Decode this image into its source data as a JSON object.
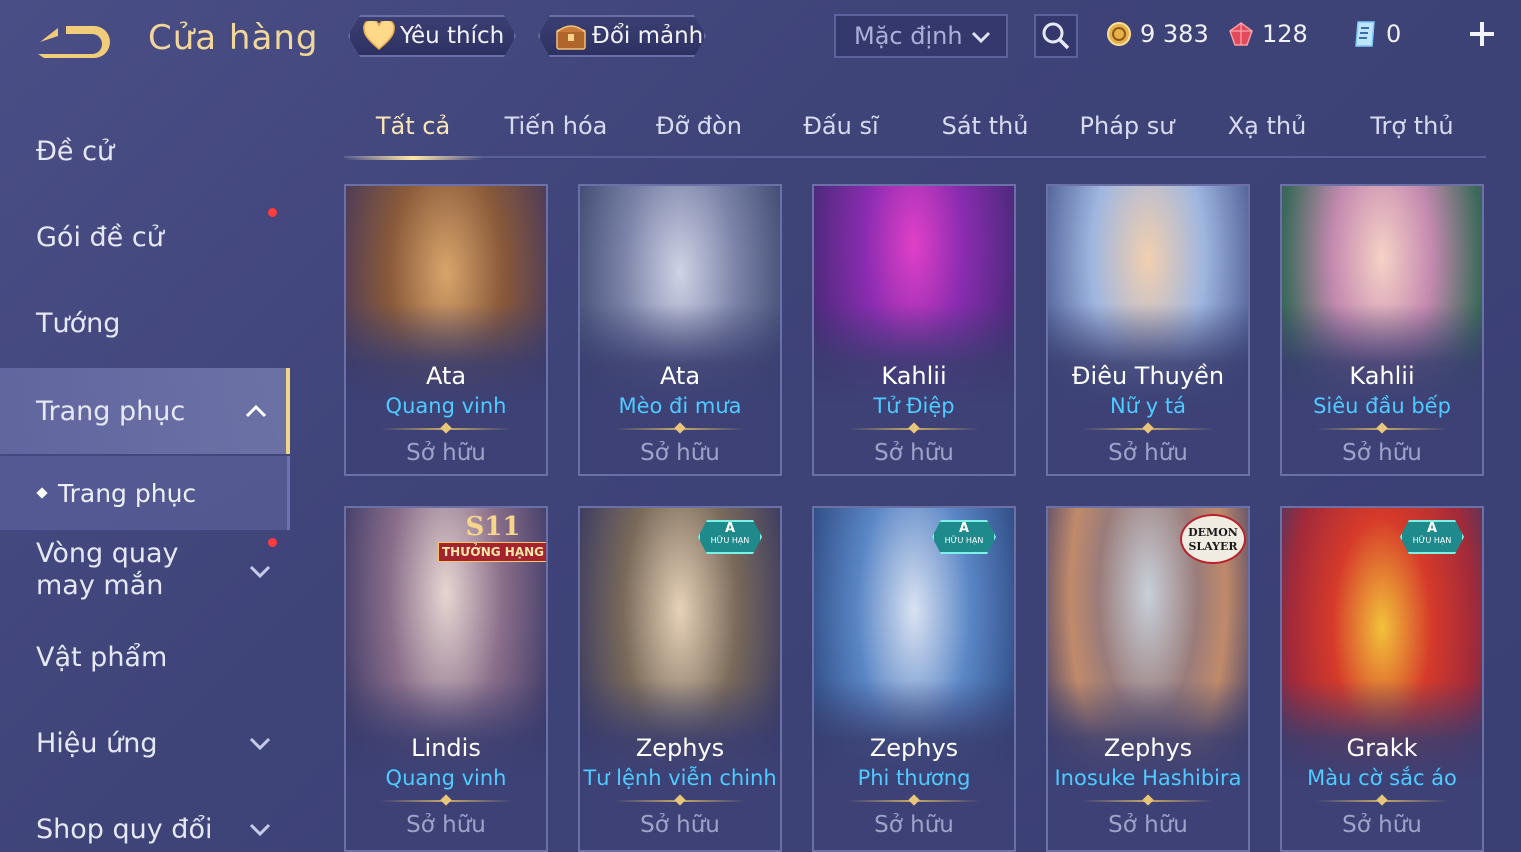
{
  "header": {
    "title": "Cửa hàng",
    "favorites_label": "Yêu thích",
    "shards_label": "Đổi mảnh",
    "sort_value": "Mặc định",
    "currencies": {
      "gold": "9 383",
      "gems": "128",
      "vouchers": "0"
    },
    "icons": {
      "back": "back-arrow-icon",
      "favorite": "heart-icon",
      "shard": "treasure-chest-icon",
      "search": "search-icon",
      "gold": "gold-coin-icon",
      "gem": "red-gem-icon",
      "voucher": "voucher-icon",
      "add": "plus-icon"
    }
  },
  "sidebar": {
    "items": [
      {
        "label": "Đề cử"
      },
      {
        "label": "Gói đề cử"
      },
      {
        "label": "Tướng"
      },
      {
        "label": "Trang phục"
      },
      {
        "label": "Vòng quay may mắn"
      },
      {
        "label": "Vật phẩm"
      },
      {
        "label": "Hiệu ứng"
      },
      {
        "label": "Shop quy đổi"
      }
    ],
    "sub_item": "Trang phục"
  },
  "tabs": [
    {
      "label": "Tất cả"
    },
    {
      "label": "Tiến hóa"
    },
    {
      "label": "Đỡ đòn"
    },
    {
      "label": "Đấu sĩ"
    },
    {
      "label": "Sát thủ"
    },
    {
      "label": "Pháp sư"
    },
    {
      "label": "Xạ thủ"
    },
    {
      "label": "Trợ thủ"
    }
  ],
  "cards": [
    {
      "hero": "Ata",
      "skin": "Quang vinh",
      "status": "Sở hữu",
      "badge": ""
    },
    {
      "hero": "Ata",
      "skin": "Mèo đi mưa",
      "status": "Sở hữu",
      "badge": ""
    },
    {
      "hero": "Kahlii",
      "skin": "Tử Điệp",
      "status": "Sở hữu",
      "badge": ""
    },
    {
      "hero": "Điêu Thuyền",
      "skin": "Nữ y tá",
      "status": "Sở hữu",
      "badge": ""
    },
    {
      "hero": "Kahlii",
      "skin": "Siêu đầu bếp",
      "status": "Sở hữu",
      "badge": ""
    },
    {
      "hero": "Lindis",
      "skin": "Quang vinh",
      "status": "Sở hữu",
      "badge": "S11",
      "badge_sub": "THƯỞNG HẠNG"
    },
    {
      "hero": "Zephys",
      "skin": "Tư lệnh viễn chinh",
      "status": "Sở hữu",
      "badge": "A",
      "badge_sub": "HỮU HẠN"
    },
    {
      "hero": "Zephys",
      "skin": "Phi thương",
      "status": "Sở hữu",
      "badge": "A",
      "badge_sub": "HỮU HẠN"
    },
    {
      "hero": "Zephys",
      "skin": "Inosuke Hashibira",
      "status": "Sở hữu",
      "badge": "DEMON SLAYER"
    },
    {
      "hero": "Grakk",
      "skin": "Màu cờ sắc áo",
      "status": "Sở hữu",
      "badge": "A",
      "badge_sub": "HỮU HẠN"
    }
  ],
  "colors": {
    "accent_gold": "#f1d79a",
    "skin_name": "#4ecbff",
    "notification": "#ff3b3b"
  }
}
